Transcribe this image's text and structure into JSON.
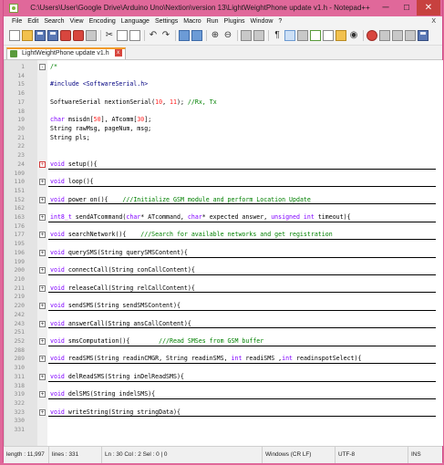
{
  "window": {
    "title": "C:\\Users\\User\\Google Drive\\Arduino Uno\\Nextion\\version 13\\LightWeightPhone update v1.h - Notepad++",
    "minimize_glyph": "─",
    "maximize_glyph": "☐",
    "close_glyph": "✕"
  },
  "menu": {
    "items": [
      "File",
      "Edit",
      "Search",
      "View",
      "Encoding",
      "Language",
      "Settings",
      "Macro",
      "Run",
      "Plugins",
      "Window",
      "?"
    ],
    "close_glyph": "X"
  },
  "toolbar": {
    "icons": [
      "new-file-icon",
      "open-folder-icon",
      "save-icon",
      "save-all-icon",
      "close-file-icon",
      "close-all-icon",
      "print-icon",
      "cut-icon",
      "copy-icon",
      "paste-icon",
      "undo-icon",
      "redo-icon",
      "find-icon",
      "replace-icon",
      "zoom-in-icon",
      "zoom-out-icon",
      "sync-vertical-icon",
      "sync-horizontal-icon",
      "word-wrap-icon",
      "show-all-chars-icon",
      "indent-guide-icon",
      "document-map-icon",
      "function-list-icon",
      "folder-workspace-icon",
      "monitoring-icon",
      "record-macro-icon"
    ]
  },
  "tab": {
    "label": "LightWeightPhone update v1.h",
    "close_glyph": "x"
  },
  "editor": {
    "lines": [
      {
        "num": "1",
        "fold": "-",
        "fold_red": false,
        "underline": false,
        "tokens": [
          {
            "t": "/*",
            "c": "cm"
          }
        ]
      },
      {
        "num": "14",
        "fold": "",
        "fold_red": false,
        "underline": false,
        "tokens": []
      },
      {
        "num": "15",
        "fold": "",
        "fold_red": false,
        "underline": false,
        "tokens": [
          {
            "t": "#include <SoftwareSerial.h>",
            "c": "op"
          }
        ]
      },
      {
        "num": "16",
        "fold": "",
        "fold_red": false,
        "underline": false,
        "tokens": []
      },
      {
        "num": "17",
        "fold": "",
        "fold_red": false,
        "underline": false,
        "tokens": [
          {
            "t": "SoftwareSerial nextionSerial(",
            "c": ""
          },
          {
            "t": "10",
            "c": "num"
          },
          {
            "t": ", ",
            "c": ""
          },
          {
            "t": "11",
            "c": "num"
          },
          {
            "t": "); ",
            "c": ""
          },
          {
            "t": "//Rx, Tx",
            "c": "cm"
          }
        ]
      },
      {
        "num": "18",
        "fold": "",
        "fold_red": false,
        "underline": false,
        "tokens": []
      },
      {
        "num": "19",
        "fold": "",
        "fold_red": false,
        "underline": false,
        "tokens": [
          {
            "t": "char",
            "c": "type"
          },
          {
            "t": " msisdn[",
            "c": ""
          },
          {
            "t": "50",
            "c": "num"
          },
          {
            "t": "], ATcomm[",
            "c": ""
          },
          {
            "t": "30",
            "c": "num"
          },
          {
            "t": "];",
            "c": ""
          }
        ]
      },
      {
        "num": "20",
        "fold": "",
        "fold_red": false,
        "underline": false,
        "tokens": [
          {
            "t": "String rawMsg, pageNum, msg;",
            "c": ""
          }
        ]
      },
      {
        "num": "21",
        "fold": "",
        "fold_red": false,
        "underline": false,
        "tokens": [
          {
            "t": "String pls;",
            "c": ""
          }
        ]
      },
      {
        "num": "22",
        "fold": "",
        "fold_red": false,
        "underline": false,
        "tokens": []
      },
      {
        "num": "23",
        "fold": "",
        "fold_red": false,
        "underline": false,
        "tokens": []
      },
      {
        "num": "24",
        "fold": "+",
        "fold_red": true,
        "underline": true,
        "tokens": [
          {
            "t": "void",
            "c": "type"
          },
          {
            "t": " setup(){",
            "c": ""
          }
        ]
      },
      {
        "num": "109",
        "fold": "",
        "fold_red": false,
        "underline": false,
        "tokens": []
      },
      {
        "num": "110",
        "fold": "+",
        "fold_red": false,
        "underline": true,
        "tokens": [
          {
            "t": "void",
            "c": "type"
          },
          {
            "t": " loop(){",
            "c": ""
          }
        ]
      },
      {
        "num": "151",
        "fold": "",
        "fold_red": false,
        "underline": false,
        "tokens": []
      },
      {
        "num": "152",
        "fold": "+",
        "fold_red": false,
        "underline": true,
        "tokens": [
          {
            "t": "void",
            "c": "type"
          },
          {
            "t": " power on(){    ",
            "c": ""
          },
          {
            "t": "///Initialize GSM module and perform Location Update",
            "c": "cm"
          }
        ]
      },
      {
        "num": "162",
        "fold": "",
        "fold_red": false,
        "underline": false,
        "tokens": []
      },
      {
        "num": "163",
        "fold": "+",
        "fold_red": false,
        "underline": true,
        "tokens": [
          {
            "t": "int8_t",
            "c": "type"
          },
          {
            "t": " sendATcommand(",
            "c": ""
          },
          {
            "t": "char",
            "c": "type"
          },
          {
            "t": "* ATcommand, ",
            "c": ""
          },
          {
            "t": "char",
            "c": "type"
          },
          {
            "t": "* expected answer, ",
            "c": ""
          },
          {
            "t": "unsigned int",
            "c": "type"
          },
          {
            "t": " timeout){",
            "c": ""
          }
        ]
      },
      {
        "num": "176",
        "fold": "",
        "fold_red": false,
        "underline": false,
        "tokens": []
      },
      {
        "num": "177",
        "fold": "+",
        "fold_red": false,
        "underline": true,
        "tokens": [
          {
            "t": "void",
            "c": "type"
          },
          {
            "t": " searchNetwork(){    ",
            "c": ""
          },
          {
            "t": "///Search for available networks and get registration",
            "c": "cm"
          }
        ]
      },
      {
        "num": "195",
        "fold": "",
        "fold_red": false,
        "underline": false,
        "tokens": []
      },
      {
        "num": "196",
        "fold": "+",
        "fold_red": false,
        "underline": true,
        "tokens": [
          {
            "t": "void",
            "c": "type"
          },
          {
            "t": " querySMS(String querySMSContent){",
            "c": ""
          }
        ]
      },
      {
        "num": "199",
        "fold": "",
        "fold_red": false,
        "underline": false,
        "tokens": []
      },
      {
        "num": "200",
        "fold": "+",
        "fold_red": false,
        "underline": true,
        "tokens": [
          {
            "t": "void",
            "c": "type"
          },
          {
            "t": " connectCall(String conCallContent){",
            "c": ""
          }
        ]
      },
      {
        "num": "210",
        "fold": "",
        "fold_red": false,
        "underline": false,
        "tokens": []
      },
      {
        "num": "211",
        "fold": "+",
        "fold_red": false,
        "underline": true,
        "tokens": [
          {
            "t": "void",
            "c": "type"
          },
          {
            "t": " releaseCall(String relCallContent){",
            "c": ""
          }
        ]
      },
      {
        "num": "219",
        "fold": "",
        "fold_red": false,
        "underline": false,
        "tokens": []
      },
      {
        "num": "220",
        "fold": "+",
        "fold_red": false,
        "underline": true,
        "tokens": [
          {
            "t": "void",
            "c": "type"
          },
          {
            "t": " sendSMS(String sendSMSContent){",
            "c": ""
          }
        ]
      },
      {
        "num": "242",
        "fold": "",
        "fold_red": false,
        "underline": false,
        "tokens": []
      },
      {
        "num": "243",
        "fold": "+",
        "fold_red": false,
        "underline": true,
        "tokens": [
          {
            "t": "void",
            "c": "type"
          },
          {
            "t": " answerCall(String ansCallContent){",
            "c": ""
          }
        ]
      },
      {
        "num": "251",
        "fold": "",
        "fold_red": false,
        "underline": false,
        "tokens": []
      },
      {
        "num": "252",
        "fold": "+",
        "fold_red": false,
        "underline": true,
        "tokens": [
          {
            "t": "void",
            "c": "type"
          },
          {
            "t": " smsComputation(){        ",
            "c": ""
          },
          {
            "t": "///Read SMSes from GSM buffer",
            "c": "cm"
          }
        ]
      },
      {
        "num": "288",
        "fold": "",
        "fold_red": false,
        "underline": false,
        "tokens": []
      },
      {
        "num": "289",
        "fold": "+",
        "fold_red": false,
        "underline": true,
        "tokens": [
          {
            "t": "void",
            "c": "type"
          },
          {
            "t": " readSMS(String readinCMGR, String readinSMS, ",
            "c": ""
          },
          {
            "t": "int",
            "c": "type"
          },
          {
            "t": " readiSMS ,",
            "c": ""
          },
          {
            "t": "int",
            "c": "type"
          },
          {
            "t": " readinspotSelect){",
            "c": ""
          }
        ]
      },
      {
        "num": "310",
        "fold": "",
        "fold_red": false,
        "underline": false,
        "tokens": []
      },
      {
        "num": "311",
        "fold": "+",
        "fold_red": false,
        "underline": true,
        "tokens": [
          {
            "t": "void",
            "c": "type"
          },
          {
            "t": " delReadSMS(String inDelReadSMS){",
            "c": ""
          }
        ]
      },
      {
        "num": "318",
        "fold": "",
        "fold_red": false,
        "underline": false,
        "tokens": []
      },
      {
        "num": "319",
        "fold": "+",
        "fold_red": false,
        "underline": true,
        "tokens": [
          {
            "t": "void",
            "c": "type"
          },
          {
            "t": " delSMS(String indelSMS){",
            "c": ""
          }
        ]
      },
      {
        "num": "322",
        "fold": "",
        "fold_red": false,
        "underline": false,
        "tokens": []
      },
      {
        "num": "323",
        "fold": "+",
        "fold_red": false,
        "underline": true,
        "tokens": [
          {
            "t": "void",
            "c": "type"
          },
          {
            "t": " writeString(String stringData){",
            "c": ""
          }
        ]
      },
      {
        "num": "330",
        "fold": "",
        "fold_red": false,
        "underline": false,
        "tokens": []
      },
      {
        "num": "331",
        "fold": "",
        "fold_red": false,
        "underline": false,
        "tokens": []
      }
    ]
  },
  "status": {
    "length": "length : 11,997",
    "lines": "lines : 331",
    "position": "Ln : 30   Col : 2   Sel : 0 | 0",
    "eol": "Windows (CR LF)",
    "encoding": "UTF-8",
    "mode": "INS"
  }
}
